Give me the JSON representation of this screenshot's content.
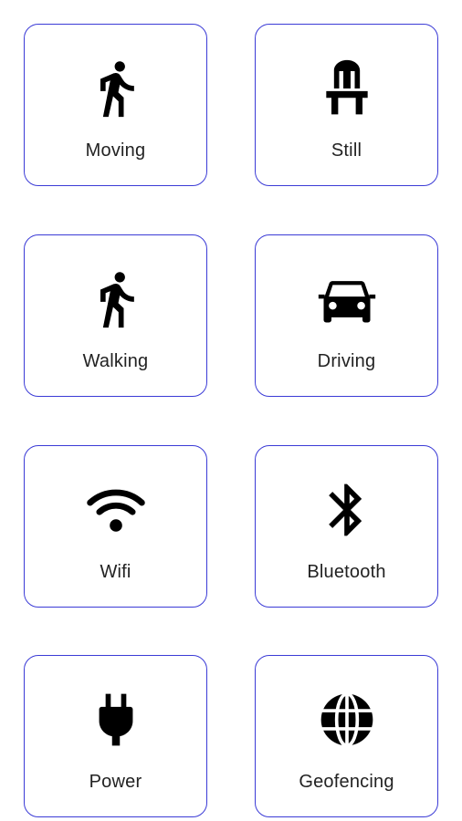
{
  "accent_color": "#3b3bd6",
  "tiles": [
    {
      "label": "Moving",
      "icon": "walking-person-icon"
    },
    {
      "label": "Still",
      "icon": "chair-icon"
    },
    {
      "label": "Walking",
      "icon": "walking-person-icon"
    },
    {
      "label": "Driving",
      "icon": "car-icon"
    },
    {
      "label": "Wifi",
      "icon": "wifi-icon"
    },
    {
      "label": "Bluetooth",
      "icon": "bluetooth-icon"
    },
    {
      "label": "Power",
      "icon": "power-plug-icon"
    },
    {
      "label": "Geofencing",
      "icon": "globe-icon"
    }
  ]
}
